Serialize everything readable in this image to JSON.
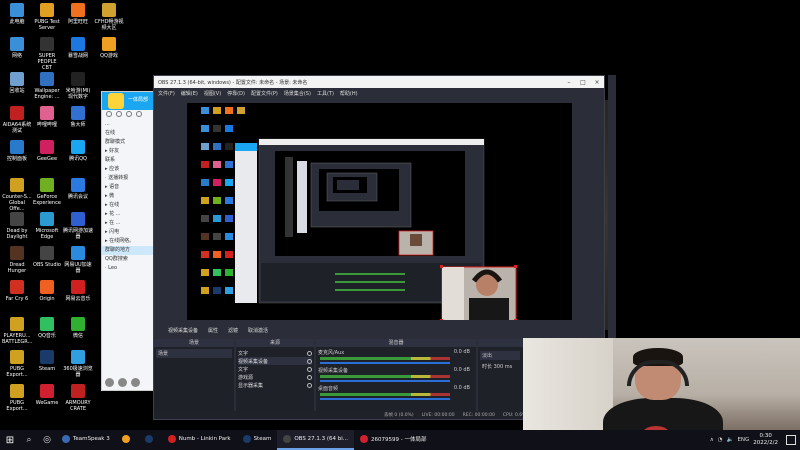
{
  "desktop_icons": [
    {
      "label": "此电脑",
      "color": "#3b8fd9"
    },
    {
      "label": "PUBG Test\nServer",
      "color": "#e0a020"
    },
    {
      "label": "阿里旺旺",
      "color": "#f07020"
    },
    {
      "label": "CFHD畅游视\n频大区",
      "color": "#d0a030"
    },
    {
      "label": "网络",
      "color": "#3b8fd9"
    },
    {
      "label": "SUPER\nPEOPLE CBT",
      "color": "#333333"
    },
    {
      "label": "暴雪战网",
      "color": "#1a78e0"
    },
    {
      "label": "QQ游戏",
      "color": "#f0a020"
    },
    {
      "label": "回收站",
      "color": "#6fa0d0"
    },
    {
      "label": "Wallpaper\nEngine: ...",
      "color": "#3070c0"
    },
    {
      "label": "米哈游(MI)\n现代数字",
      "color": "#222222"
    },
    {
      "label": "AIDA64系统\n测试",
      "color": "#c02020"
    },
    {
      "label": "哔哩哔哩",
      "color": "#e06090"
    },
    {
      "label": "鲁大师",
      "color": "#3070d0"
    },
    {
      "label": "控制面板",
      "color": "#2a7acc"
    },
    {
      "label": "GeeGee",
      "color": "#d02060"
    },
    {
      "label": "腾讯QQ",
      "color": "#1aa6f0"
    },
    {
      "label": "Counter-S...\nGlobal Offe...",
      "color": "#d0a020"
    },
    {
      "label": "GeForce\nExperience",
      "color": "#70b020"
    },
    {
      "label": "腾讯会议",
      "color": "#2a7ae0"
    },
    {
      "label": "Dead by\nDaylight",
      "color": "#444444"
    },
    {
      "label": "Microsoft\nEdge",
      "color": "#2a9ad0"
    },
    {
      "label": "腾讯网游加速\n器",
      "color": "#3060d0"
    },
    {
      "label": "Dread\nHunger",
      "color": "#553322"
    },
    {
      "label": "OBS Studio",
      "color": "#444444"
    },
    {
      "label": "网易UU加速\n器",
      "color": "#2a8ae0"
    },
    {
      "label": "Far Cry 6",
      "color": "#d03020"
    },
    {
      "label": "Origin",
      "color": "#f06020"
    },
    {
      "label": "网易云音乐",
      "color": "#d02020"
    },
    {
      "label": "PLAYERU...\nBATTLEGR...",
      "color": "#d0a020"
    },
    {
      "label": "QQ音乐",
      "color": "#30c060"
    },
    {
      "label": "微信",
      "color": "#30b030"
    },
    {
      "label": "PUBG\nExport...",
      "color": "#d0a020"
    },
    {
      "label": "Steam",
      "color": "#1a3a6a"
    },
    {
      "label": "360极速浏览\n器",
      "color": "#30a0e0"
    },
    {
      "label": "PUBG\nExport...",
      "color": "#d0a020"
    },
    {
      "label": "WeGame",
      "color": "#d02030"
    },
    {
      "label": "ARMOURY\nCRATE",
      "color": "#c02020"
    }
  ],
  "qq": {
    "title": "一体局部",
    "rows": [
      "...",
      "在线",
      "群聊模式",
      "▸ 好友",
      "联系",
      "▸ 应该",
      "· 送播转报",
      "▸ 语音",
      "▸ 微",
      "▸ 在线",
      "▸ 花 ...",
      "▸ 在 ...",
      "▸ 闪电",
      "▸ 在线网络。",
      "群聊的地方",
      "QQ群搜索",
      "· Leo"
    ]
  },
  "obs": {
    "title": "OBS 27.1.3 (64-bit, windows) - 配置文件: 未命名 - 场景: 未命名",
    "menu": [
      "文件(F)",
      "编辑(E)",
      "视图(V)",
      "停靠(D)",
      "配置文件(P)",
      "场景集合(S)",
      "工具(T)",
      "帮助(H)"
    ],
    "dock_toolbar": [
      "视频采集设备",
      "属性",
      "滤镜",
      "取消激活"
    ],
    "docks": {
      "scenes": {
        "header": "场景",
        "items": [
          "场景"
        ]
      },
      "sources": {
        "header": "来源",
        "items": [
          "文字",
          "视频采集设备",
          "文字",
          "游戏源",
          "显示器采集"
        ]
      },
      "mixer": {
        "header": "混音器",
        "tracks": [
          {
            "name": "麦克风/Aux",
            "db": "0.0 dB"
          },
          {
            "name": "视频采集设备",
            "db": "0.0 dB"
          },
          {
            "name": "桌面音频",
            "db": "0.0 dB"
          }
        ]
      },
      "transitions": {
        "header": "转场特效",
        "items": [
          "淡出",
          "时长 300 ms"
        ]
      }
    },
    "status": [
      "丢帧 0 (0.0%)",
      "LIVE: 00:00:00",
      "REC: 00:00:00",
      "CPU: 0.6%, 60.00 fps"
    ]
  },
  "taskbar": {
    "apps": [
      {
        "label": "TeamSpeak 3",
        "color": "#3a6ab0"
      },
      {
        "label": "",
        "color": "#f0a020"
      },
      {
        "label": "",
        "color": "#1a3a6a"
      },
      {
        "label": "Numb - Linkin Park",
        "color": "#d02020"
      },
      {
        "label": "Steam",
        "color": "#1a3a6a"
      },
      {
        "label": "OBS 27.1.3 (64 bi...",
        "color": "#444444"
      },
      {
        "label": "26079599 - 一体局部",
        "color": "#d02030"
      }
    ],
    "tray": {
      "lang": "ENG",
      "time": "0:30",
      "date": "2022/2/2"
    }
  }
}
